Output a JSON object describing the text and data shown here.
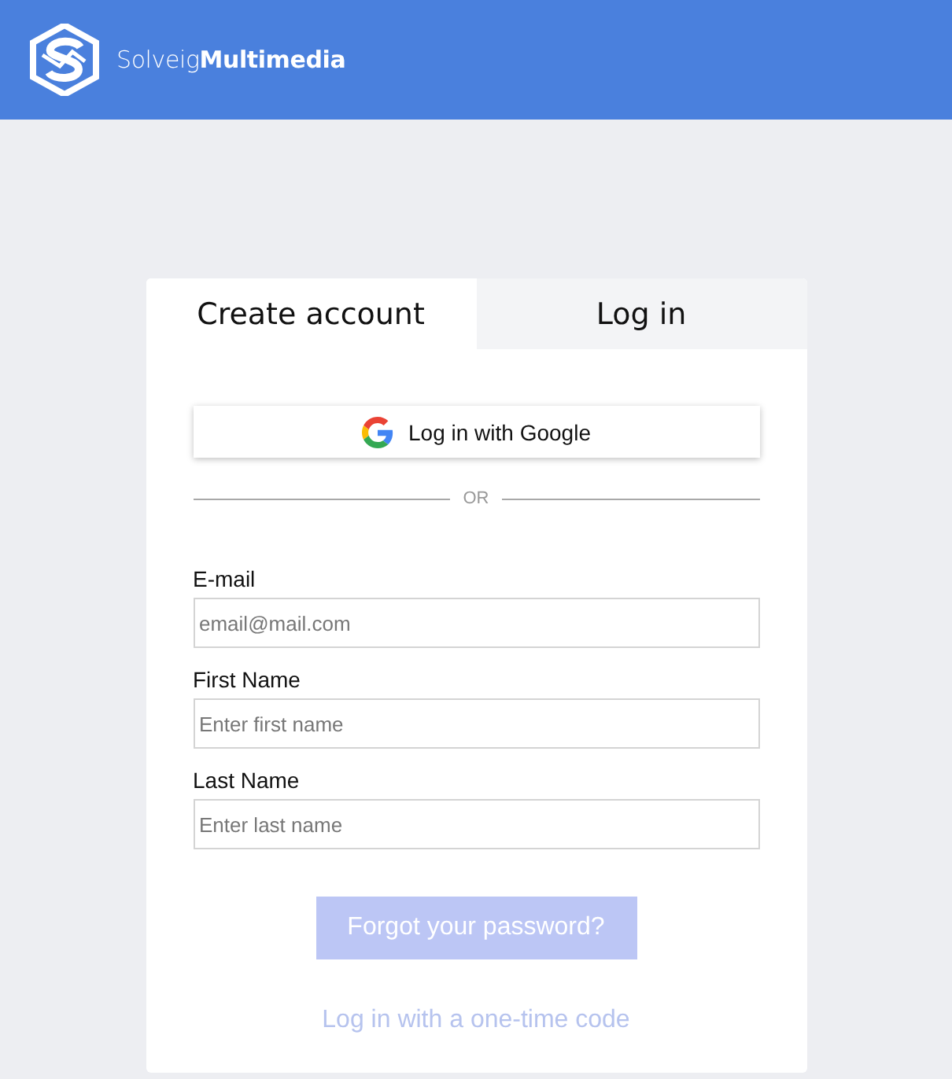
{
  "header": {
    "brand": "Solveig**Multimedia**"
  },
  "tabs": [
    {
      "label": "Create account",
      "selected": true
    },
    {
      "label": "Log in",
      "selected": false
    }
  ],
  "google_button": {
    "label": "Log in with Google"
  },
  "divider": {
    "label": "OR"
  },
  "fields": [
    {
      "label": "E-mail",
      "placeholder": "email@mail.com"
    },
    {
      "label": "First Name",
      "placeholder": "Enter first name"
    },
    {
      "label": "Last Name",
      "placeholder": "Enter last name"
    }
  ],
  "forgot_button": {
    "label": "Forgot your password?"
  },
  "code_link": {
    "label": "Log in with a one-time code"
  }
}
